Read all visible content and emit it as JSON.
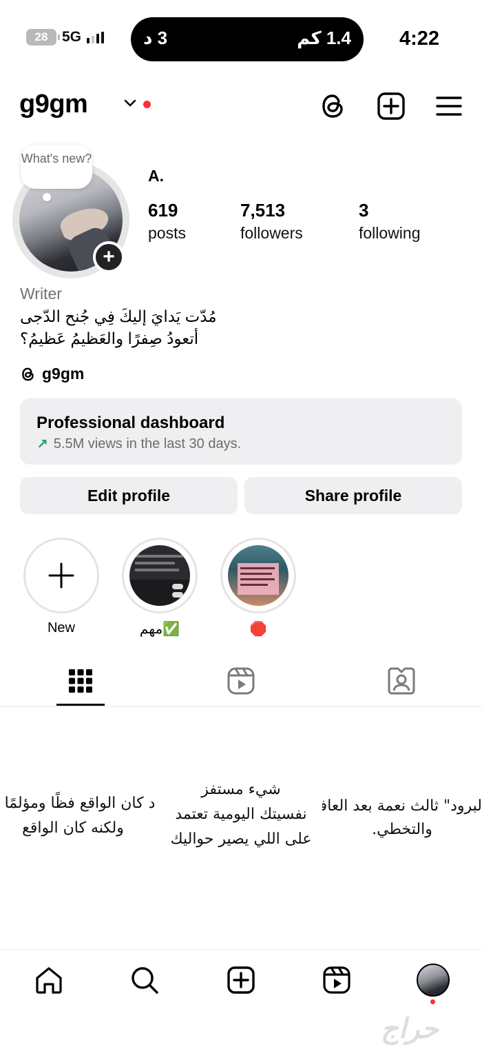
{
  "status_bar": {
    "battery": "28",
    "network": "5G",
    "island_left": "3 د",
    "island_right": "1.4 كم",
    "time": "4:22"
  },
  "header": {
    "username": "g9gm"
  },
  "profile": {
    "note": "What's new?",
    "display_name": "A.",
    "stats": [
      {
        "value": "619",
        "label": "posts"
      },
      {
        "value": "7,513",
        "label": "followers"
      },
      {
        "value": "3",
        "label": "following"
      }
    ],
    "category": "Writer",
    "bio_line1": "مُدّت يَدايَ إليكَ فِي جُنح الدّجى",
    "bio_line2": "أتعودُ صِفرًا والعَظيمُ عَظيمُ؟",
    "threads_handle": "g9gm"
  },
  "dashboard": {
    "title": "Professional dashboard",
    "subtitle": "5.5M views in the last 30 days."
  },
  "buttons": {
    "edit": "Edit profile",
    "share": "Share profile"
  },
  "highlights": [
    {
      "label": "New"
    },
    {
      "label": "مهم✅"
    },
    {
      "label": "🛑"
    }
  ],
  "posts": [
    {
      "lines": [
        "د كان الواقع فظًا ومؤلمًا",
        "ولكنه كان الواقع"
      ]
    },
    {
      "lines": [
        "شيء مستفز",
        "نفسيتك اليومية تعتمد",
        "على اللي يصير حواليك"
      ]
    },
    {
      "lines": [
        "لبرود\" ثالث نعمة بعد العافية",
        "والتخطي."
      ]
    }
  ],
  "watermark": "حراج",
  "colors": {
    "notification_red": "#ff2d3a",
    "trend_green": "#1e9e6a",
    "button_bg": "#efeff1"
  }
}
